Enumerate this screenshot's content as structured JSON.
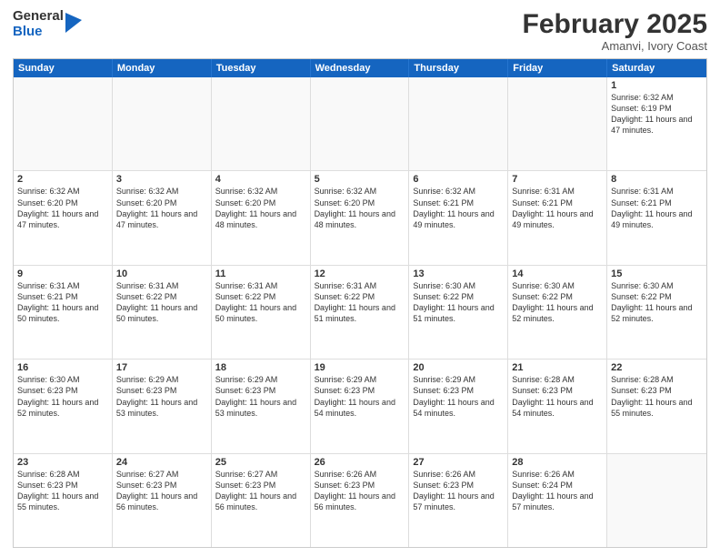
{
  "logo": {
    "general": "General",
    "blue": "Blue"
  },
  "header": {
    "month": "February 2025",
    "location": "Amanvi, Ivory Coast"
  },
  "dayHeaders": [
    "Sunday",
    "Monday",
    "Tuesday",
    "Wednesday",
    "Thursday",
    "Friday",
    "Saturday"
  ],
  "weeks": [
    [
      {
        "day": "",
        "info": ""
      },
      {
        "day": "",
        "info": ""
      },
      {
        "day": "",
        "info": ""
      },
      {
        "day": "",
        "info": ""
      },
      {
        "day": "",
        "info": ""
      },
      {
        "day": "",
        "info": ""
      },
      {
        "day": "1",
        "info": "Sunrise: 6:32 AM\nSunset: 6:19 PM\nDaylight: 11 hours and 47 minutes."
      }
    ],
    [
      {
        "day": "2",
        "info": "Sunrise: 6:32 AM\nSunset: 6:20 PM\nDaylight: 11 hours and 47 minutes."
      },
      {
        "day": "3",
        "info": "Sunrise: 6:32 AM\nSunset: 6:20 PM\nDaylight: 11 hours and 47 minutes."
      },
      {
        "day": "4",
        "info": "Sunrise: 6:32 AM\nSunset: 6:20 PM\nDaylight: 11 hours and 48 minutes."
      },
      {
        "day": "5",
        "info": "Sunrise: 6:32 AM\nSunset: 6:20 PM\nDaylight: 11 hours and 48 minutes."
      },
      {
        "day": "6",
        "info": "Sunrise: 6:32 AM\nSunset: 6:21 PM\nDaylight: 11 hours and 49 minutes."
      },
      {
        "day": "7",
        "info": "Sunrise: 6:31 AM\nSunset: 6:21 PM\nDaylight: 11 hours and 49 minutes."
      },
      {
        "day": "8",
        "info": "Sunrise: 6:31 AM\nSunset: 6:21 PM\nDaylight: 11 hours and 49 minutes."
      }
    ],
    [
      {
        "day": "9",
        "info": "Sunrise: 6:31 AM\nSunset: 6:21 PM\nDaylight: 11 hours and 50 minutes."
      },
      {
        "day": "10",
        "info": "Sunrise: 6:31 AM\nSunset: 6:22 PM\nDaylight: 11 hours and 50 minutes."
      },
      {
        "day": "11",
        "info": "Sunrise: 6:31 AM\nSunset: 6:22 PM\nDaylight: 11 hours and 50 minutes."
      },
      {
        "day": "12",
        "info": "Sunrise: 6:31 AM\nSunset: 6:22 PM\nDaylight: 11 hours and 51 minutes."
      },
      {
        "day": "13",
        "info": "Sunrise: 6:30 AM\nSunset: 6:22 PM\nDaylight: 11 hours and 51 minutes."
      },
      {
        "day": "14",
        "info": "Sunrise: 6:30 AM\nSunset: 6:22 PM\nDaylight: 11 hours and 52 minutes."
      },
      {
        "day": "15",
        "info": "Sunrise: 6:30 AM\nSunset: 6:22 PM\nDaylight: 11 hours and 52 minutes."
      }
    ],
    [
      {
        "day": "16",
        "info": "Sunrise: 6:30 AM\nSunset: 6:23 PM\nDaylight: 11 hours and 52 minutes."
      },
      {
        "day": "17",
        "info": "Sunrise: 6:29 AM\nSunset: 6:23 PM\nDaylight: 11 hours and 53 minutes."
      },
      {
        "day": "18",
        "info": "Sunrise: 6:29 AM\nSunset: 6:23 PM\nDaylight: 11 hours and 53 minutes."
      },
      {
        "day": "19",
        "info": "Sunrise: 6:29 AM\nSunset: 6:23 PM\nDaylight: 11 hours and 54 minutes."
      },
      {
        "day": "20",
        "info": "Sunrise: 6:29 AM\nSunset: 6:23 PM\nDaylight: 11 hours and 54 minutes."
      },
      {
        "day": "21",
        "info": "Sunrise: 6:28 AM\nSunset: 6:23 PM\nDaylight: 11 hours and 54 minutes."
      },
      {
        "day": "22",
        "info": "Sunrise: 6:28 AM\nSunset: 6:23 PM\nDaylight: 11 hours and 55 minutes."
      }
    ],
    [
      {
        "day": "23",
        "info": "Sunrise: 6:28 AM\nSunset: 6:23 PM\nDaylight: 11 hours and 55 minutes."
      },
      {
        "day": "24",
        "info": "Sunrise: 6:27 AM\nSunset: 6:23 PM\nDaylight: 11 hours and 56 minutes."
      },
      {
        "day": "25",
        "info": "Sunrise: 6:27 AM\nSunset: 6:23 PM\nDaylight: 11 hours and 56 minutes."
      },
      {
        "day": "26",
        "info": "Sunrise: 6:26 AM\nSunset: 6:23 PM\nDaylight: 11 hours and 56 minutes."
      },
      {
        "day": "27",
        "info": "Sunrise: 6:26 AM\nSunset: 6:23 PM\nDaylight: 11 hours and 57 minutes."
      },
      {
        "day": "28",
        "info": "Sunrise: 6:26 AM\nSunset: 6:24 PM\nDaylight: 11 hours and 57 minutes."
      },
      {
        "day": "",
        "info": ""
      }
    ]
  ]
}
